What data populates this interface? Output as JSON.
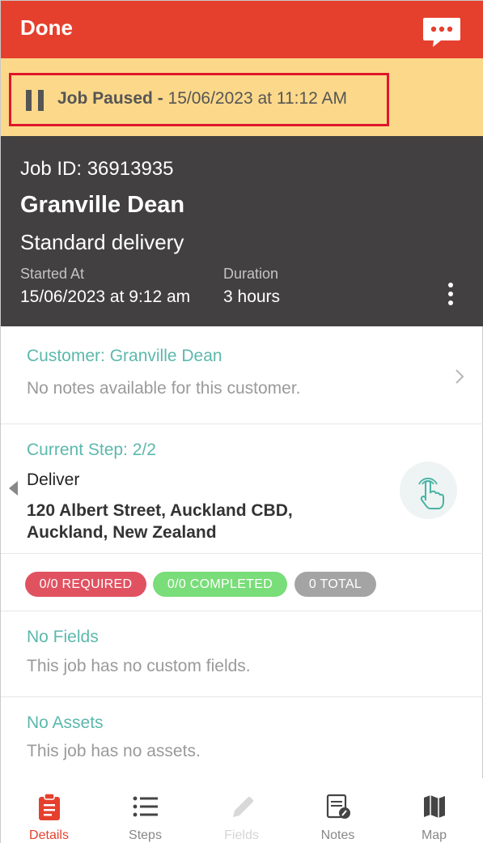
{
  "header": {
    "done_label": "Done",
    "chat_icon": "chat-bubble-icon",
    "color": "#e5402d"
  },
  "status_bar": {
    "status": "Job Paused -",
    "timestamp": "15/06/2023 at 11:12 AM",
    "icon": "pause-icon"
  },
  "job": {
    "id_text": "Job ID: 36913935",
    "name": "Granville Dean",
    "type": "Standard delivery",
    "started_label": "Started At",
    "started_value": "15/06/2023 at 9:12 am",
    "duration_label": "Duration",
    "duration_value": "3 hours"
  },
  "customer": {
    "title": "Customer: Granville Dean",
    "notes": "No notes available for this customer."
  },
  "current_step": {
    "title": "Current Step: 2/2",
    "action": "Deliver",
    "address_line1": "120 Albert Street, Auckland CBD,",
    "address_line2": "Auckland, New Zealand"
  },
  "badges": {
    "required": "0/0 REQUIRED",
    "completed": "0/0 COMPLETED",
    "total": "0 TOTAL"
  },
  "fields": {
    "title": "No Fields",
    "text": "This job has no custom fields."
  },
  "assets": {
    "title": "No Assets",
    "text": "This job has no assets."
  },
  "tabs": [
    {
      "label": "Details",
      "icon": "clipboard-icon",
      "state": "active"
    },
    {
      "label": "Steps",
      "icon": "list-icon",
      "state": "normal"
    },
    {
      "label": "Fields",
      "icon": "pencil-icon",
      "state": "disabled"
    },
    {
      "label": "Notes",
      "icon": "notes-icon",
      "state": "normal"
    },
    {
      "label": "Map",
      "icon": "map-icon",
      "state": "normal"
    }
  ],
  "colors": {
    "accent": "#e5402d",
    "teal": "#5cb8ac",
    "required": "#e15261",
    "completed": "#79dd79",
    "total": "#a5a4a4"
  }
}
